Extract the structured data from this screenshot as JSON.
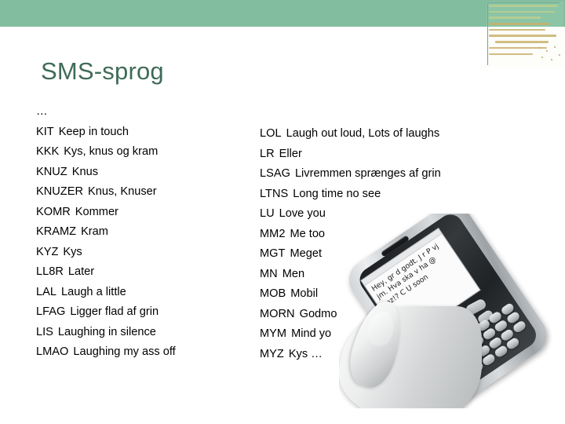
{
  "slide": {
    "title": "SMS-sprog",
    "band_color": "#83bd9f",
    "title_color": "#3f6b57"
  },
  "left_column": {
    "lead": "…",
    "entries": [
      {
        "abbr": "KIT",
        "meaning": "Keep in touch"
      },
      {
        "abbr": "KKK",
        "meaning": "Kys, knus og kram"
      },
      {
        "abbr": "KNUZ",
        "meaning": "Knus"
      },
      {
        "abbr": "KNUZER",
        "meaning": "Knus, Knuser"
      },
      {
        "abbr": "KOMR",
        "meaning": "Kommer"
      },
      {
        "abbr": "KRAMZ",
        "meaning": "Kram"
      },
      {
        "abbr": "KYZ",
        "meaning": "Kys"
      },
      {
        "abbr": "LL8R",
        "meaning": "Later"
      },
      {
        "abbr": "LAL",
        "meaning": "Laugh a little"
      },
      {
        "abbr": "LFAG",
        "meaning": "Ligger flad af grin"
      },
      {
        "abbr": "LIS",
        "meaning": "Laughing in silence"
      },
      {
        "abbr": "LMAO",
        "meaning": "Laughing my ass off"
      }
    ]
  },
  "right_column": {
    "entries": [
      {
        "abbr": "LOL",
        "meaning": "Laugh out loud, Lots of laughs"
      },
      {
        "abbr": "LR",
        "meaning": "Eller"
      },
      {
        "abbr": "LSAG",
        "meaning": "Livremmen sprænges af grin"
      },
      {
        "abbr": "LTNS",
        "meaning": "Long time no see"
      },
      {
        "abbr": "LU",
        "meaning": "Love you"
      },
      {
        "abbr": "MM2",
        "meaning": "Me too"
      },
      {
        "abbr": "MGT",
        "meaning": "Meget"
      },
      {
        "abbr": "MN",
        "meaning": "Men"
      },
      {
        "abbr": "MOB",
        "meaning": "Mobil"
      },
      {
        "abbr": "MORN",
        "meaning": "Godmo"
      },
      {
        "abbr": "MYM",
        "meaning": "Mind yo"
      },
      {
        "abbr": "MYZ",
        "meaning": "Kys …"
      }
    ]
  },
  "phone_photo": {
    "sms_text": "Hey, gr d godt. J r P vj jm. Hva ska v ha @ spz!? C U soon"
  }
}
